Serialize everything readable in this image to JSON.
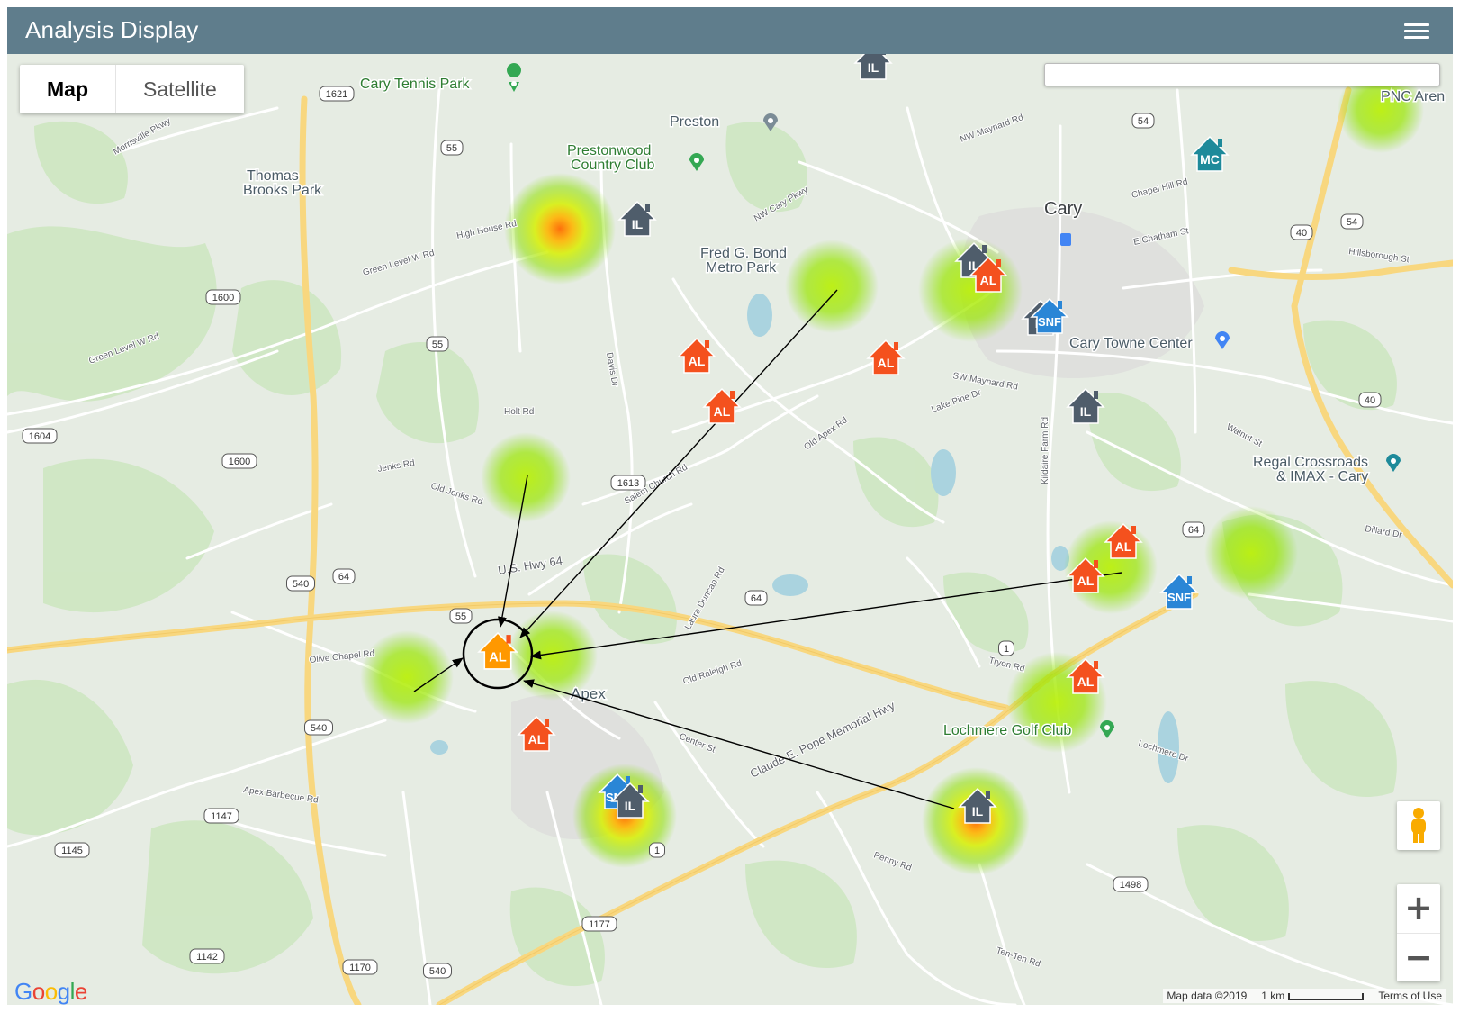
{
  "app": {
    "title": "Analysis Display",
    "menu_icon": "hamburger-icon"
  },
  "map_type": {
    "map_label": "Map",
    "satellite_label": "Satellite",
    "selected": "Map"
  },
  "search": {
    "value": "",
    "placeholder": ""
  },
  "colors": {
    "header": "#5f7d8c",
    "AL": "#f4511e",
    "IL": "#4f5d6b",
    "MC": "#1e8a9a",
    "SNF": "#2a86d6",
    "highlight_ring": "#000000"
  },
  "place_labels": [
    {
      "text": "Cary Tennis Park"
    },
    {
      "text": "Preston"
    },
    {
      "text": "Prestonwood"
    },
    {
      "text": "Country Club"
    },
    {
      "text": "Thomas"
    },
    {
      "text": "Brooks Park"
    },
    {
      "text": "Fred G. Bond"
    },
    {
      "text": "Metro Park"
    },
    {
      "text": "Cary"
    },
    {
      "text": "Cary Towne Center"
    },
    {
      "text": "Regal Crossroads"
    },
    {
      "text": "& IMAX - Cary"
    },
    {
      "text": "Lochmere Golf Club"
    },
    {
      "text": "Apex"
    },
    {
      "text": "PNC Aren"
    }
  ],
  "road_labels": [
    {
      "text": "U.S. Hwy 64"
    },
    {
      "text": "Claude E. Pope Memorial Hwy"
    },
    {
      "text": "High House Rd"
    },
    {
      "text": "Green Level W Rd"
    },
    {
      "text": "Holt Rd"
    },
    {
      "text": "Jenks Rd"
    },
    {
      "text": "Old Jenks Rd"
    },
    {
      "text": "Olive Chapel Rd"
    },
    {
      "text": "Apex Barbecue Rd"
    },
    {
      "text": "SW Maynard Rd"
    },
    {
      "text": "NW Maynard Rd"
    },
    {
      "text": "Chapel Hill Rd"
    },
    {
      "text": "E Chatham St"
    },
    {
      "text": "Tryon Rd"
    },
    {
      "text": "Kildaire Farm Rd"
    },
    {
      "text": "Penny Rd"
    },
    {
      "text": "Ten-Ten Rd"
    },
    {
      "text": "Old Apex Rd"
    },
    {
      "text": "Salem Church Rd"
    },
    {
      "text": "Center St"
    },
    {
      "text": "Lake Pine Dr"
    },
    {
      "text": "Walnut St"
    },
    {
      "text": "Dillard Dr"
    },
    {
      "text": "Lochmere Dr"
    },
    {
      "text": "Hillsborough St"
    },
    {
      "text": "Laura Duncan Rd"
    },
    {
      "text": "Old Raleigh Rd"
    },
    {
      "text": "NW Cary Pkwy"
    },
    {
      "text": "Davis Dr"
    },
    {
      "text": "Green Level W Rd"
    },
    {
      "text": "Morrisville Pkwy"
    }
  ],
  "route_shields": [
    "1621",
    "55",
    "1600",
    "55",
    "1604",
    "1600",
    "1613",
    "64",
    "540",
    "55",
    "64",
    "540",
    "1",
    "1147",
    "1145",
    "1",
    "1177",
    "1142",
    "1170",
    "540",
    "54",
    "54",
    "64",
    "40",
    "40",
    "1498"
  ],
  "markers": [
    {
      "type": "IL"
    },
    {
      "type": "IL"
    },
    {
      "type": "IL"
    },
    {
      "type": "AL"
    },
    {
      "type": "IL"
    },
    {
      "type": "SNF"
    },
    {
      "type": "IL"
    },
    {
      "type": "AL"
    },
    {
      "type": "AL"
    },
    {
      "type": "AL"
    },
    {
      "type": "MC"
    },
    {
      "type": "AL"
    },
    {
      "type": "AL"
    },
    {
      "type": "SNF"
    },
    {
      "type": "AL"
    },
    {
      "type": "AL"
    },
    {
      "type": "IL"
    },
    {
      "type": "SNF"
    },
    {
      "type": "IL"
    }
  ],
  "selected_marker": {
    "type": "AL"
  },
  "controls": {
    "zoom_in": "+",
    "zoom_out": "−",
    "pegman_icon": "pegman-icon"
  },
  "footer": {
    "google_logo": "Google",
    "map_data": "Map data ©2019",
    "scale_label": "1 km",
    "terms": "Terms of Use"
  }
}
